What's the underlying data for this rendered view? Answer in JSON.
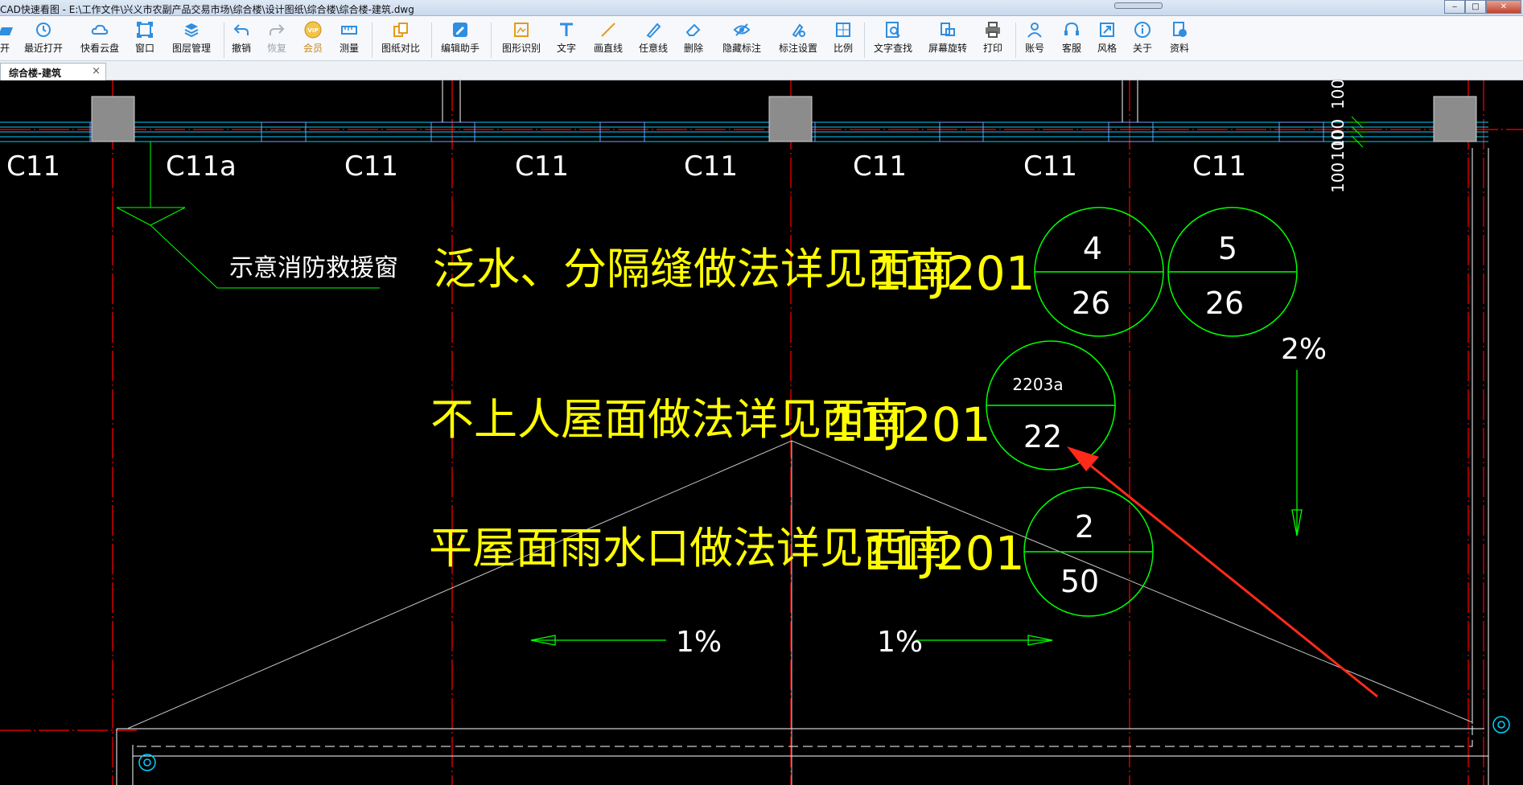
{
  "window": {
    "title": "CAD快速看图 - E:\\工作文件\\兴义市农副产品交易市场\\综合楼\\设计图纸\\综合楼\\综合楼-建筑.dwg",
    "minimize": "‒",
    "maximize": "□",
    "close": "✕"
  },
  "toolbar": {
    "items": [
      {
        "label": "开",
        "icon": "open-icon"
      },
      {
        "label": "最近打开",
        "icon": "recent-icon"
      },
      {
        "label": "快看云盘",
        "icon": "cloud-icon"
      },
      {
        "label": "窗口",
        "icon": "window-icon"
      },
      {
        "label": "图层管理",
        "icon": "layers-icon"
      },
      {
        "label": "撤销",
        "icon": "undo-icon"
      },
      {
        "label": "恢复",
        "icon": "redo-icon"
      },
      {
        "label": "会员",
        "icon": "vip-icon"
      },
      {
        "label": "测量",
        "icon": "measure-icon"
      },
      {
        "label": "图纸对比",
        "icon": "compare-icon"
      },
      {
        "label": "编辑助手",
        "icon": "edit-assistant-icon"
      },
      {
        "label": "图形识别",
        "icon": "shape-recognition-icon"
      },
      {
        "label": "文字",
        "icon": "text-icon"
      },
      {
        "label": "画直线",
        "icon": "line-icon"
      },
      {
        "label": "任意线",
        "icon": "freehand-icon"
      },
      {
        "label": "删除",
        "icon": "eraser-icon"
      },
      {
        "label": "隐藏标注",
        "icon": "hide-annotation-icon"
      },
      {
        "label": "标注设置",
        "icon": "annotation-settings-icon"
      },
      {
        "label": "比例",
        "icon": "scale-icon"
      },
      {
        "label": "文字查找",
        "icon": "text-search-icon"
      },
      {
        "label": "屏幕旋转",
        "icon": "rotate-screen-icon"
      },
      {
        "label": "打印",
        "icon": "print-icon"
      },
      {
        "label": "账号",
        "icon": "account-icon"
      },
      {
        "label": "客服",
        "icon": "support-icon"
      },
      {
        "label": "风格",
        "icon": "style-icon"
      },
      {
        "label": "关于",
        "icon": "about-icon"
      },
      {
        "label": "资料",
        "icon": "documents-icon"
      }
    ],
    "vip_badge": "VIP"
  },
  "tabs": [
    {
      "label": "综合楼-建筑",
      "close": "×",
      "active": true
    }
  ],
  "drawing": {
    "window_labels": [
      "C11",
      "C11a",
      "C11",
      "C11",
      "C11",
      "C11",
      "C11",
      "C11"
    ],
    "dimension_labels": [
      "100",
      "100",
      "100",
      "100"
    ],
    "callout": "示意消防救援窗",
    "notes": [
      {
        "text": "泛水、分隔缝做法详见西南",
        "code": "11J201"
      },
      {
        "text": "不上人屋面做法详见西南",
        "code": "11J201"
      },
      {
        "text": "平屋面雨水口做法详见西南",
        "code": "11J201"
      }
    ],
    "detail_symbols": [
      {
        "top": "4",
        "bottom": "26"
      },
      {
        "top": "5",
        "bottom": "26"
      },
      {
        "top": "2203a",
        "bottom": "22"
      },
      {
        "top": "2",
        "bottom": "50"
      }
    ],
    "slopes": [
      "2%",
      "1%",
      "1%"
    ],
    "colors": {
      "background": "#000000",
      "axis": "#ff0000",
      "wall": "#ffffff",
      "text": "#ffff00",
      "annotation": "#00ff00",
      "window_line": "#00ffff",
      "column": "#808080",
      "markup_arrow": "#ff2a1a"
    }
  }
}
